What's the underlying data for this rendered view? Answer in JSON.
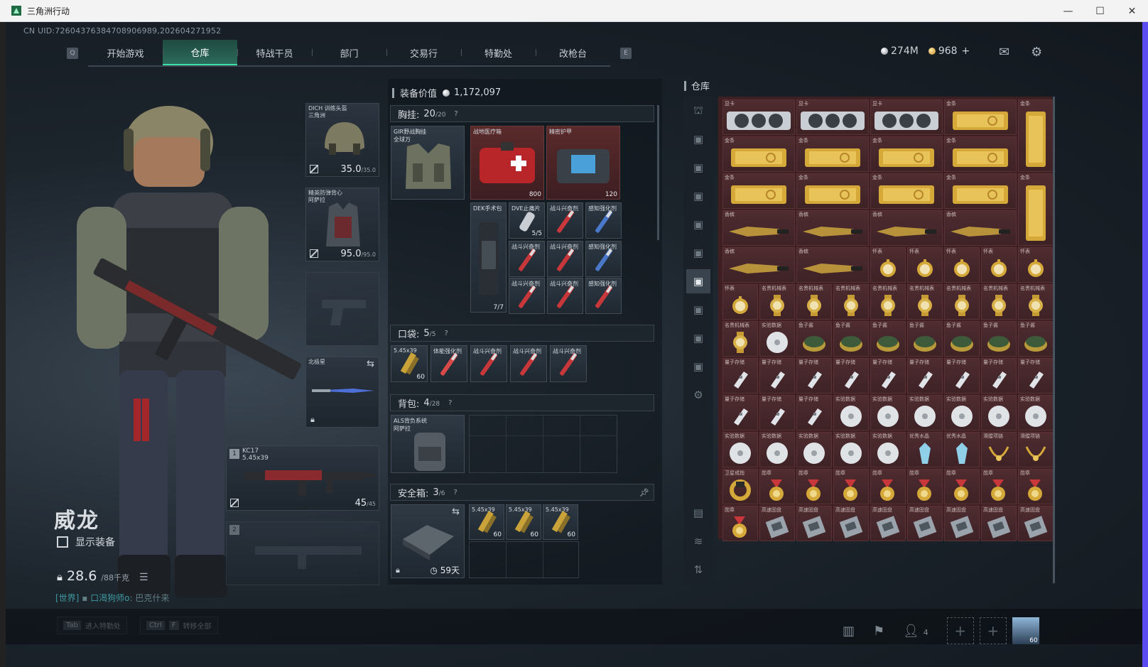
{
  "window": {
    "title": "三角洲行动",
    "min": "—",
    "max": "☐",
    "close": "✕"
  },
  "uid": "CN UID:7260437638470890698​9,202604271952",
  "nav": {
    "left_key": "Q",
    "right_key": "E",
    "tabs": [
      {
        "label": "开始游戏"
      },
      {
        "label": "仓库"
      },
      {
        "label": "特战干员"
      },
      {
        "label": "部门"
      },
      {
        "label": "交易行"
      },
      {
        "label": "特勤处"
      },
      {
        "label": "改枪台"
      }
    ],
    "active": 1
  },
  "currency": {
    "silver": "274M",
    "gold": "968",
    "plus": "+"
  },
  "character": {
    "name": "威龙",
    "show_equip": "显示装备",
    "weight": "28.6",
    "weight_unit": "/88千克",
    "world_prefix": "[世界]",
    "world_user": "口渴狗师o",
    "world_msg": ": 巴克什来"
  },
  "hotkeys": [
    {
      "keys": [
        "Tab"
      ],
      "label": "进入特勤处"
    },
    {
      "keys": [
        "Ctrl",
        "F"
      ],
      "label": "转移全部"
    }
  ],
  "slots": {
    "helmet": {
      "name": "DICH 训练头盔",
      "sub": "三角洲",
      "dur": "35.0",
      "max": "/35.0"
    },
    "armor": {
      "name": "精英防弹背心",
      "sub": "阿萨拉",
      "dur": "95.0",
      "max": "/95.0"
    },
    "melee": {
      "name": "北极星"
    },
    "gun1": {
      "num": "1",
      "name": "KC17",
      "cal": "5.45x39",
      "ammo": "45",
      "max": "/45"
    },
    "gun2": {
      "num": "2"
    }
  },
  "equipment": {
    "label": "装备价值",
    "value": "1,172,097",
    "chest": {
      "label": "胸挂:",
      "count": "20",
      "max": "/20",
      "q": "?"
    },
    "chest_rig": "GIR野战胸挂",
    "chest_rig_sub": "全球万",
    "chest_items": [
      {
        "name": "战地医疗箱",
        "count": "800"
      },
      {
        "name": "精密护甲",
        "count": "120"
      },
      {
        "name": "DEK手术包",
        "count": "7/7"
      },
      {
        "name": "DVE止痛片",
        "count": "5/5"
      },
      {
        "name": "战斗兴奋剂",
        "count": ""
      },
      {
        "name": "感知强化剂",
        "count": ""
      }
    ],
    "pocket": {
      "label": "口袋:",
      "count": "5",
      "max": "/5",
      "q": "?"
    },
    "pocket_items": [
      {
        "name": "5.45x39",
        "count": "60"
      },
      {
        "name": "体能强化剂",
        "count": ""
      },
      {
        "name": "战斗兴奋剂",
        "count": ""
      },
      {
        "name": "战斗兴奋剂",
        "count": ""
      },
      {
        "name": "战斗兴奋剂",
        "count": ""
      }
    ],
    "backpack": {
      "label": "背包:",
      "count": "4",
      "max": "/28",
      "q": "?"
    },
    "backpack_name": "ALS背负系统",
    "backpack_sub": "阿萨拉",
    "safe": {
      "label": "安全箱:",
      "count": "3",
      "max": "/6",
      "q": "?",
      "days": "59天"
    },
    "safe_items": [
      {
        "name": "5.45x39",
        "count": "60"
      },
      {
        "name": "5.45x39",
        "count": "60"
      },
      {
        "name": "5.45x39",
        "count": "60"
      }
    ]
  },
  "storage": {
    "label": "仓库",
    "rows": [
      [
        "显卡",
        "显卡",
        "显卡",
        "金条",
        "金条"
      ],
      [
        "金条",
        "金条",
        "金条",
        "金条",
        ""
      ],
      [
        "金条",
        "金条",
        "金条",
        "金条",
        "金条"
      ],
      [
        "香槟",
        "香槟",
        "香槟",
        "香槟",
        ""
      ],
      [
        "香槟",
        "香槟",
        "怀表",
        "怀表",
        "怀表",
        "怀表",
        "怀表"
      ],
      [
        "怀表",
        "名贵机械表",
        "名贵机械表",
        "名贵机械表",
        "名贵机械表",
        "名贵机械表",
        "名贵机械表",
        "名贵机械表",
        "名贵机械表"
      ],
      [
        "名贵机械表",
        "实验数据",
        "鱼子酱",
        "鱼子酱",
        "鱼子酱",
        "鱼子酱",
        "鱼子酱",
        "鱼子酱",
        "鱼子酱"
      ],
      [
        "量子存储",
        "量子存储",
        "量子存储",
        "量子存储",
        "量子存储",
        "量子存储",
        "量子存储",
        "量子存储",
        "量子存储"
      ],
      [
        "量子存储",
        "量子存储",
        "量子存储",
        "实验数据",
        "实验数据",
        "实验数据",
        "实验数据",
        "实验数据",
        "实验数据"
      ],
      [
        "实验数据",
        "实验数据",
        "实验数据",
        "实验数据",
        "实验数据",
        "优秀水晶",
        "优秀水晶",
        "滑膛项链",
        "滑膛项链"
      ],
      [
        "卫星戒指",
        "勋章",
        "勋章",
        "勋章",
        "勋章",
        "勋章",
        "勋章",
        "勋章",
        "勋章"
      ],
      [
        "勋章",
        "高速固盘",
        "高速固盘",
        "高速固盘",
        "高速固盘",
        "高速固盘",
        "高速固盘",
        "高速固盘",
        "高速固盘"
      ]
    ]
  },
  "bottom": {
    "friends": "4",
    "level": "60"
  },
  "colors": {
    "accent": "#3fe0a8",
    "storage_bg": "#3e2023",
    "gold": "#d4a93a"
  }
}
